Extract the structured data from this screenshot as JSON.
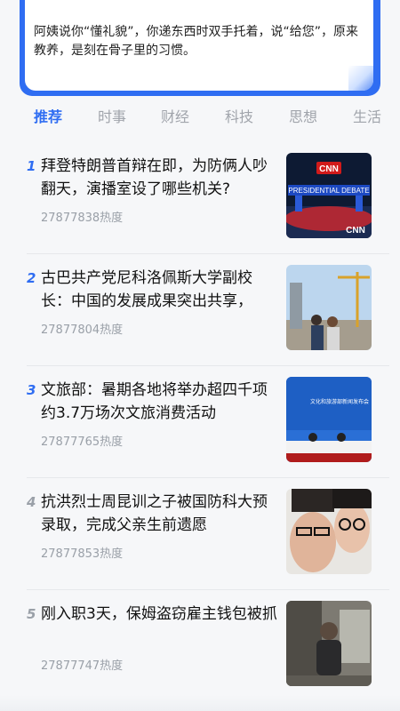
{
  "top_card": {
    "text": "阿姨说你“懂礼貌”，你递东西时双手托着，说“给您”，原来教养，是刻在骨子里的习惯。"
  },
  "tabs": [
    {
      "label": "推荐",
      "active": true
    },
    {
      "label": "时事",
      "active": false
    },
    {
      "label": "财经",
      "active": false
    },
    {
      "label": "科技",
      "active": false
    },
    {
      "label": "思想",
      "active": false
    },
    {
      "label": "生活",
      "active": false
    }
  ],
  "items": [
    {
      "rank": "1",
      "title": "拜登特朗普首辩在即，为防俩人吵翻天，演播室设了哪些机关?",
      "heat": "27877838热度",
      "thumb": "debate-stage-image"
    },
    {
      "rank": "2",
      "title": "古巴共产党尼科洛佩斯大学副校长：中国的发展成果突出共享，",
      "heat": "27877804热度",
      "thumb": "construction-site-image"
    },
    {
      "rank": "3",
      "title": "文旅部：暑期各地将举办超四千项约3.7万场次文旅消费活动",
      "heat": "27877765热度",
      "thumb": "press-conference-image"
    },
    {
      "rank": "4",
      "title": "抗洪烈士周昆训之子被国防科大预录取，完成父亲生前遗愿",
      "heat": "27877853热度",
      "thumb": "father-son-photo"
    },
    {
      "rank": "5",
      "title": "刚入职3天，保姆盗窃雇主钱包被抓",
      "heat": "27877747热度",
      "thumb": "cctv-still-image"
    }
  ],
  "thumb_texts": {
    "cnn": "CNN",
    "debate": "PRESIDENTIAL DEBATE",
    "press": "文化和旅游部新闻发布会"
  },
  "colors": {
    "accent": "#2f6df2",
    "rank_grey": "#9aa0a8"
  }
}
